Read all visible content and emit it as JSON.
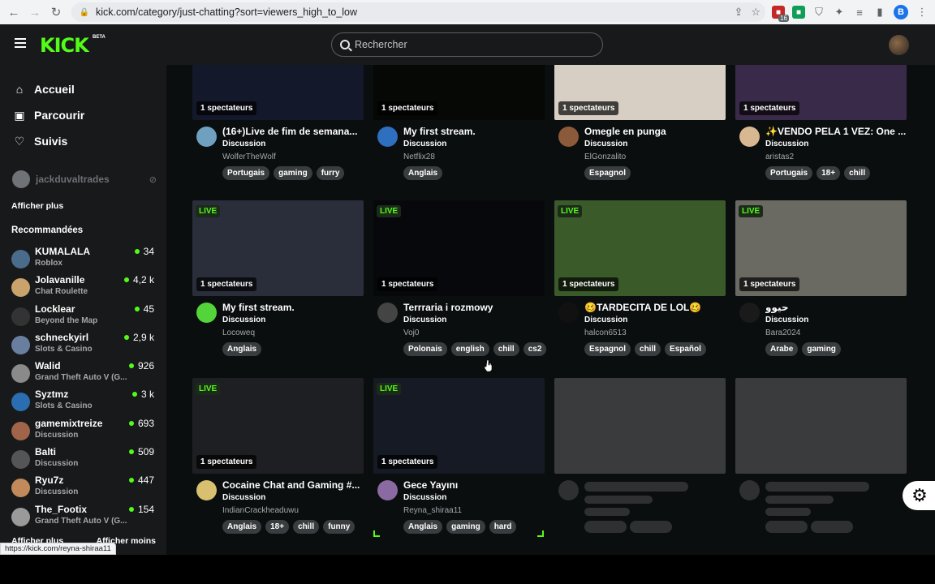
{
  "browser": {
    "url": "kick.com/category/just-chatting?sort=viewers_high_to_low",
    "profile_initial": "B",
    "badge_count": "16",
    "status_url": "https://kick.com/reyna-shiraa11"
  },
  "header": {
    "logo": "KICK",
    "logo_tag": "BETA",
    "search_placeholder": "Rechercher"
  },
  "sidebar": {
    "nav": [
      {
        "label": "Accueil",
        "icon": "home-icon"
      },
      {
        "label": "Parcourir",
        "icon": "browse-icon"
      },
      {
        "label": "Suivis",
        "icon": "heart-icon"
      }
    ],
    "followed_user": "jackduvaltrades",
    "show_more": "Afficher plus",
    "recommended_title": "Recommandées",
    "recommended": [
      {
        "name": "KUMALALA",
        "category": "Roblox",
        "viewers": "34",
        "color": "#4a6b8a"
      },
      {
        "name": "Jolavanille",
        "category": "Chat Roulette",
        "viewers": "4,2 k",
        "color": "#c9a36b"
      },
      {
        "name": "Locklear",
        "category": "Beyond the Map",
        "viewers": "45",
        "color": "#333"
      },
      {
        "name": "schneckyirl",
        "category": "Slots & Casino",
        "viewers": "2,9 k",
        "color": "#6a7fa0"
      },
      {
        "name": "Walid",
        "category": "Grand Theft Auto V (G...",
        "viewers": "926",
        "color": "#8a8a8a"
      },
      {
        "name": "Syztmz",
        "category": "Slots & Casino",
        "viewers": "3 k",
        "color": "#2a6db0"
      },
      {
        "name": "gamemixtreize",
        "category": "Discussion",
        "viewers": "693",
        "color": "#a0644a"
      },
      {
        "name": "Balti",
        "category": "Discussion",
        "viewers": "509",
        "color": "#555"
      },
      {
        "name": "Ryu7z",
        "category": "Discussion",
        "viewers": "447",
        "color": "#c08a5a"
      },
      {
        "name": "The_Footix",
        "category": "Grand Theft Auto V (G...",
        "viewers": "154",
        "color": "#9a9a9a"
      }
    ],
    "footer_more": "Afficher plus",
    "footer_less": "Afficher moins"
  },
  "cards": [
    {
      "title": "(16+)Live de fim de semana...",
      "category": "Discussion",
      "user": "WolferTheWolf",
      "viewers": "1 spectateurs",
      "tags": [
        "Portugais",
        "gaming",
        "furry"
      ],
      "live": false,
      "thumb": "#14182b",
      "avatar": "#6fa0c0"
    },
    {
      "title": "My first stream.",
      "category": "Discussion",
      "user": "Netflix28",
      "viewers": "1 spectateurs",
      "tags": [
        "Anglais"
      ],
      "live": false,
      "thumb": "#050805",
      "avatar": "#2f6fc0"
    },
    {
      "title": "Omegle en punga",
      "category": "Discussion",
      "user": "ElGonzalito",
      "viewers": "1 spectateurs",
      "tags": [
        "Espagnol"
      ],
      "live": false,
      "thumb": "#d8cfc4",
      "avatar": "#8a5a3a"
    },
    {
      "title": "✨VENDO PELA 1 VEZ: One ...",
      "category": "Discussion",
      "user": "aristas2",
      "viewers": "1 spectateurs",
      "tags": [
        "Portugais",
        "18+",
        "chill"
      ],
      "live": false,
      "thumb": "#3a2a4a",
      "avatar": "#d8b890"
    },
    {
      "title": "My first stream.",
      "category": "Discussion",
      "user": "Locoweq",
      "viewers": "1 spectateurs",
      "tags": [
        "Anglais"
      ],
      "live": true,
      "thumb": "#2a2d3a",
      "avatar": "#53d53a"
    },
    {
      "title": "Terrraria i rozmowy",
      "category": "Discussion",
      "user": "Voj0",
      "viewers": "1 spectateurs",
      "tags": [
        "Polonais",
        "english",
        "chill",
        "cs2"
      ],
      "live": true,
      "thumb": "#06080c",
      "avatar": "#444"
    },
    {
      "title": "🥴TARDECITA DE LOL🥴",
      "category": "Discussion",
      "user": "halcon6513",
      "viewers": "1 spectateurs",
      "tags": [
        "Espagnol",
        "chill",
        "Español"
      ],
      "live": true,
      "thumb": "#3a5a2a",
      "avatar": "#111"
    },
    {
      "title": "حيوو",
      "category": "Discussion",
      "user": "Bara2024",
      "viewers": "1 spectateurs",
      "tags": [
        "Arabe",
        "gaming"
      ],
      "live": true,
      "thumb": "#6a6a62",
      "avatar": "#1a1a1a"
    },
    {
      "title": "Cocaine Chat and Gaming #...",
      "category": "Discussion",
      "user": "IndianCrackheaduwu",
      "viewers": "1 spectateurs",
      "tags": [
        "Anglais",
        "18+",
        "chill",
        "funny"
      ],
      "live": true,
      "thumb": "#1e1f22",
      "avatar": "#d8c070"
    },
    {
      "title": "Gece Yayını",
      "category": "Discussion",
      "user": "Reyna_shiraa11",
      "viewers": "1 spectateurs",
      "tags": [
        "Anglais",
        "gaming",
        "hard"
      ],
      "live": true,
      "thumb": "#151a24",
      "avatar": "#8a6aa0"
    }
  ],
  "live_label": "LIVE"
}
